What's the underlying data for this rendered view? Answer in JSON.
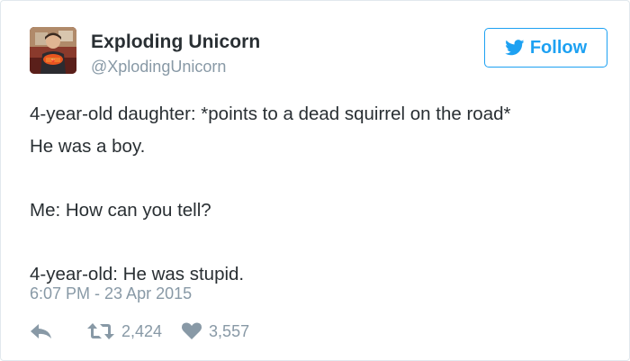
{
  "author": {
    "display_name": "Exploding Unicorn",
    "screen_name": "@XplodingUnicorn",
    "avatar_icon": "profile-photo"
  },
  "follow_button": {
    "label": "Follow",
    "icon": "twitter-bird-icon"
  },
  "tweet": {
    "lines": [
      "4-year-old daughter: *points to a dead squirrel on the road*",
      "He was a boy.",
      "",
      "Me: How can you tell?",
      "",
      "4-year-old: He was stupid."
    ],
    "timestamp": "6:07 PM - 23 Apr 2015"
  },
  "actions": {
    "reply_icon": "reply-icon",
    "retweet_icon": "retweet-icon",
    "retweet_count": "2,424",
    "like_icon": "heart-icon",
    "like_count": "3,557"
  },
  "colors": {
    "accent": "#1da1f2",
    "text": "#292f33",
    "muted": "#8899a6",
    "border": "#e1e8ed"
  }
}
